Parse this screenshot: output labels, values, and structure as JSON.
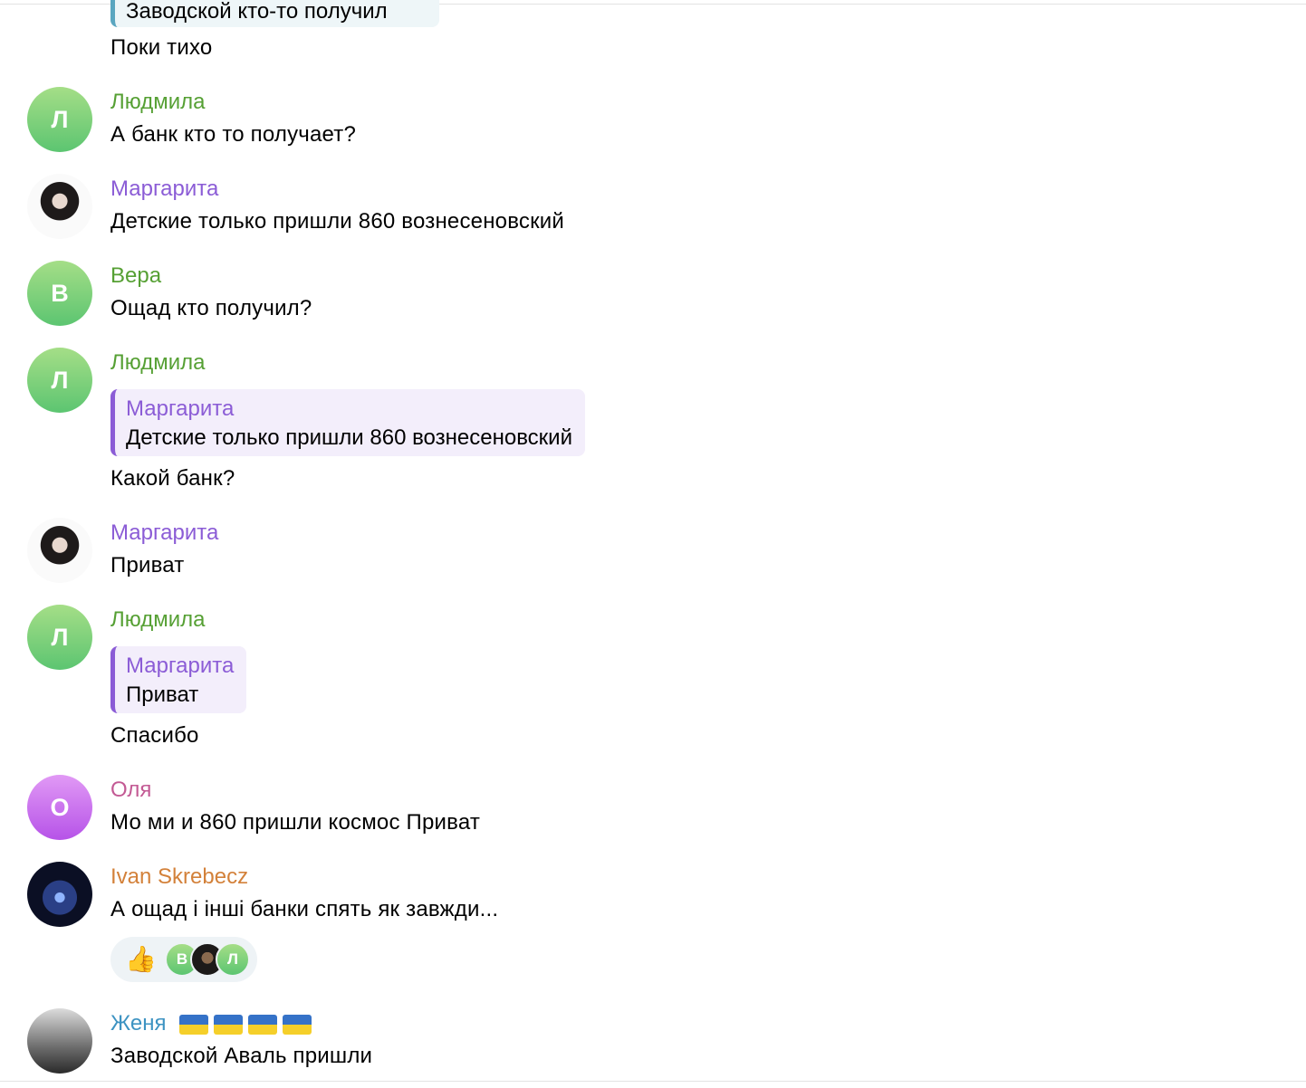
{
  "top_quote": {
    "text": "Заводской кто-то получил"
  },
  "messages": [
    {
      "text": "Поки тихо"
    },
    {
      "author": "Людмила",
      "initial": "Л",
      "text": "А банк кто то получает?"
    },
    {
      "author": "Маргарита",
      "text": "Детские только пришли 860 вознесеновский"
    },
    {
      "author": "Вера",
      "initial": "В",
      "text": "Ощад кто получил?"
    },
    {
      "author": "Людмила",
      "initial": "Л",
      "reply_to": {
        "author": "Маргарита",
        "text": "Детские только пришли 860 вознесеновский"
      },
      "text": "Какой банк?"
    },
    {
      "author": "Маргарита",
      "text": "Приват"
    },
    {
      "author": "Людмила",
      "initial": "Л",
      "reply_to": {
        "author": "Маргарита",
        "text": "Приват"
      },
      "text": "Спасибо"
    },
    {
      "author": "Оля",
      "initial": "О",
      "text": "Мо ми и 860 пришли космос Приват"
    },
    {
      "author": "Ivan Skrebecz",
      "text": "А ощад і інші банки спять як завжди...",
      "reaction": {
        "emoji": "👍",
        "users": [
          "В",
          "Л"
        ]
      }
    },
    {
      "author": "Женя",
      "text": "Заводской Аваль пришли"
    }
  ],
  "colors": {
    "green_name": "#56a034",
    "purple_name": "#8b5cd6",
    "pink_name": "#c35a94",
    "orange_name": "#d3813a",
    "blue_name": "#3d93c2"
  }
}
